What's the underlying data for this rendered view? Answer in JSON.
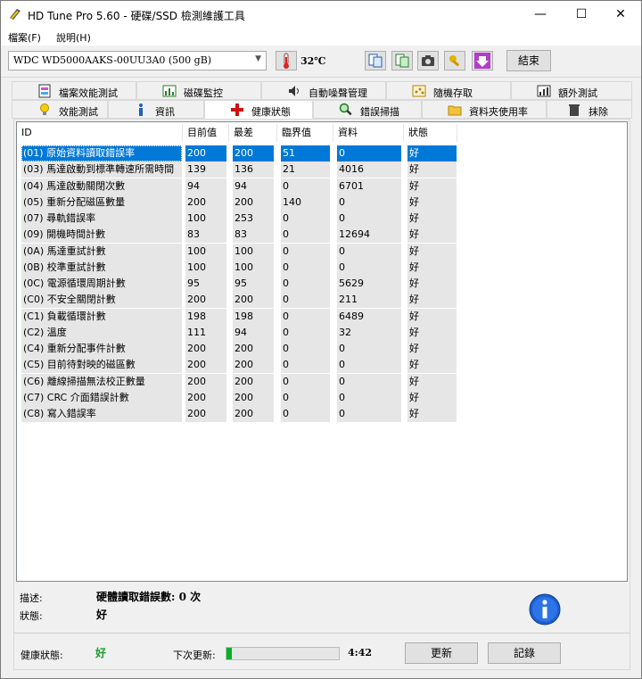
{
  "window": {
    "title": "HD Tune Pro 5.60 - 硬碟/SSD 檢測維護工具",
    "minimize": "—",
    "maximize": "☐",
    "close": "✕"
  },
  "menu": [
    "檔案(F)",
    "說明(H)"
  ],
  "toolbar": {
    "drive": "WDC WD5000AAKS-00UU3A0 (500 gB)",
    "temperature": "32℃",
    "exit_label": "結束"
  },
  "tabs_top": [
    {
      "label": "檔案效能測試",
      "icon": "file-benchmark-icon"
    },
    {
      "label": "磁碟監控",
      "icon": "disk-monitor-icon"
    },
    {
      "label": "自動噪聲管理",
      "icon": "speaker-icon"
    },
    {
      "label": "隨機存取",
      "icon": "random-access-icon"
    },
    {
      "label": "額外測試",
      "icon": "extra-tests-icon"
    }
  ],
  "tabs_bottom": [
    {
      "label": "效能測試",
      "icon": "lightbulb-icon"
    },
    {
      "label": "資訊",
      "icon": "info-icon"
    },
    {
      "label": "健康狀態",
      "icon": "health-cross-icon",
      "active": true
    },
    {
      "label": "錯誤掃描",
      "icon": "magnifier-icon"
    },
    {
      "label": "資料夾使用率",
      "icon": "folder-icon"
    },
    {
      "label": "抹除",
      "icon": "trash-icon"
    }
  ],
  "table": {
    "headers": [
      "ID",
      "目前值",
      "最差",
      "臨界值",
      "資料",
      "狀態"
    ],
    "rows": [
      [
        "(01) 原始資料讀取錯誤率",
        "200",
        "200",
        "51",
        "0",
        "好"
      ],
      [
        "(03) 馬達啟動到標準轉速所需時間",
        "139",
        "136",
        "21",
        "4016",
        "好"
      ],
      [
        "(04) 馬達啟動關閉次數",
        "94",
        "94",
        "0",
        "6701",
        "好"
      ],
      [
        "(05) 重新分配磁區數量",
        "200",
        "200",
        "140",
        "0",
        "好"
      ],
      [
        "(07) 尋軌錯誤率",
        "100",
        "253",
        "0",
        "0",
        "好"
      ],
      [
        "(09) 開機時間計數",
        "83",
        "83",
        "0",
        "12694",
        "好"
      ],
      [
        "(0A) 馬達重試計數",
        "100",
        "100",
        "0",
        "0",
        "好"
      ],
      [
        "(0B) 校準重試計數",
        "100",
        "100",
        "0",
        "0",
        "好"
      ],
      [
        "(0C) 電源循環周期計數",
        "95",
        "95",
        "0",
        "5629",
        "好"
      ],
      [
        "(C0) 不安全關閉計數",
        "200",
        "200",
        "0",
        "211",
        "好"
      ],
      [
        "(C1) 負載循環計數",
        "198",
        "198",
        "0",
        "6489",
        "好"
      ],
      [
        "(C2) 溫度",
        "111",
        "94",
        "0",
        "32",
        "好"
      ],
      [
        "(C4) 重新分配事件計數",
        "200",
        "200",
        "0",
        "0",
        "好"
      ],
      [
        "(C5) 目前待對映的磁區數",
        "200",
        "200",
        "0",
        "0",
        "好"
      ],
      [
        "(C6) 離線掃描無法校正數量",
        "200",
        "200",
        "0",
        "0",
        "好"
      ],
      [
        "(C7) CRC 介面錯誤計數",
        "200",
        "200",
        "0",
        "0",
        "好"
      ],
      [
        "(C8) 寫入錯誤率",
        "200",
        "200",
        "0",
        "0",
        "好"
      ]
    ],
    "selected_row": 0
  },
  "description": {
    "desc_label": "描述:",
    "desc_value": "硬體讀取錯誤數: 0 次",
    "status_label": "狀態:",
    "status_value": "好"
  },
  "footer": {
    "health_label": "健康狀態:",
    "health_value": "好",
    "health_color": "#1a9e2b",
    "next_update_label": "下次更新:",
    "progress_fraction": 0.05,
    "countdown": "4:42",
    "update_button": "更新",
    "log_button": "記錄"
  }
}
